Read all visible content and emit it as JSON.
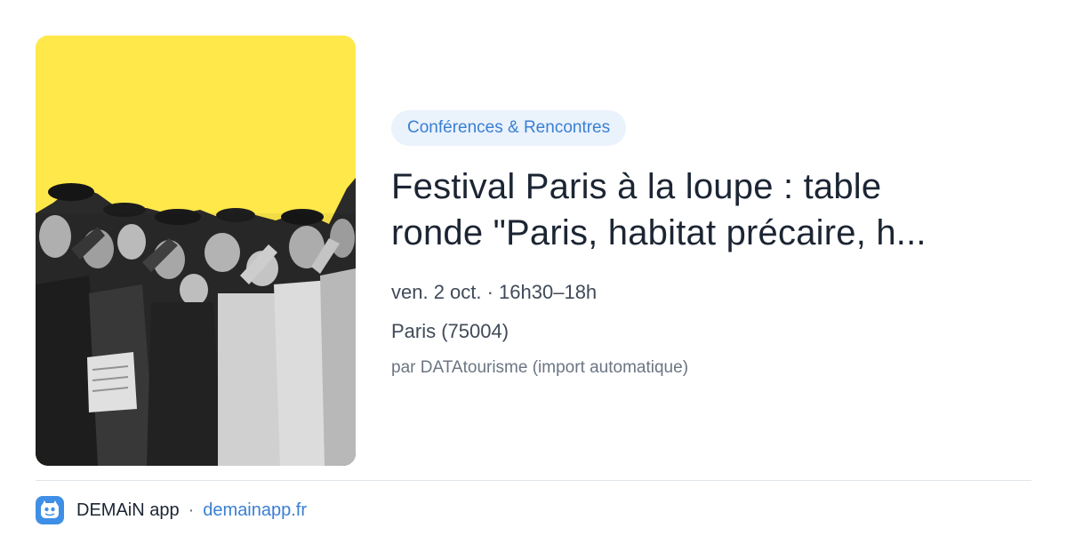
{
  "event": {
    "category": "Conférences & Rencontres",
    "title_line1": "Festival Paris à la loupe : table",
    "title_line2": "ronde \"Paris, habitat précaire, h...",
    "datetime": "ven. 2 oct. · 16h30–18h",
    "place": "Paris (75004)",
    "source": "par DATAtourisme (import automatique)"
  },
  "image": {
    "background_color": "#ffe84a",
    "description_icon": "crowd-photo"
  },
  "footer": {
    "app_name": "DEMAiN app",
    "separator": "·",
    "domain": "demainapp.fr"
  },
  "colors": {
    "accent": "#3a7fd2",
    "pill_bg": "#eaf2fc",
    "title": "#1c2533"
  }
}
